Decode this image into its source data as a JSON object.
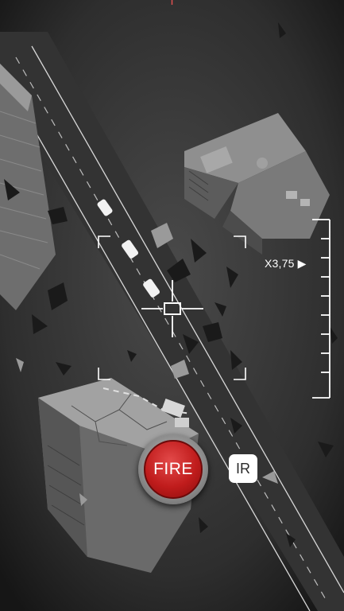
{
  "hud": {
    "zoom_readout": "X3,75 ▶",
    "fire_label": "FIRE",
    "mode_label": "IR"
  },
  "icons": {
    "crosshair": "crosshair-icon",
    "zoom_indicator": "zoom-arrow-icon"
  },
  "colors": {
    "fire_red": "#c01c1c",
    "hud_white": "#ffffff",
    "terrain": "#3a3a3a"
  }
}
